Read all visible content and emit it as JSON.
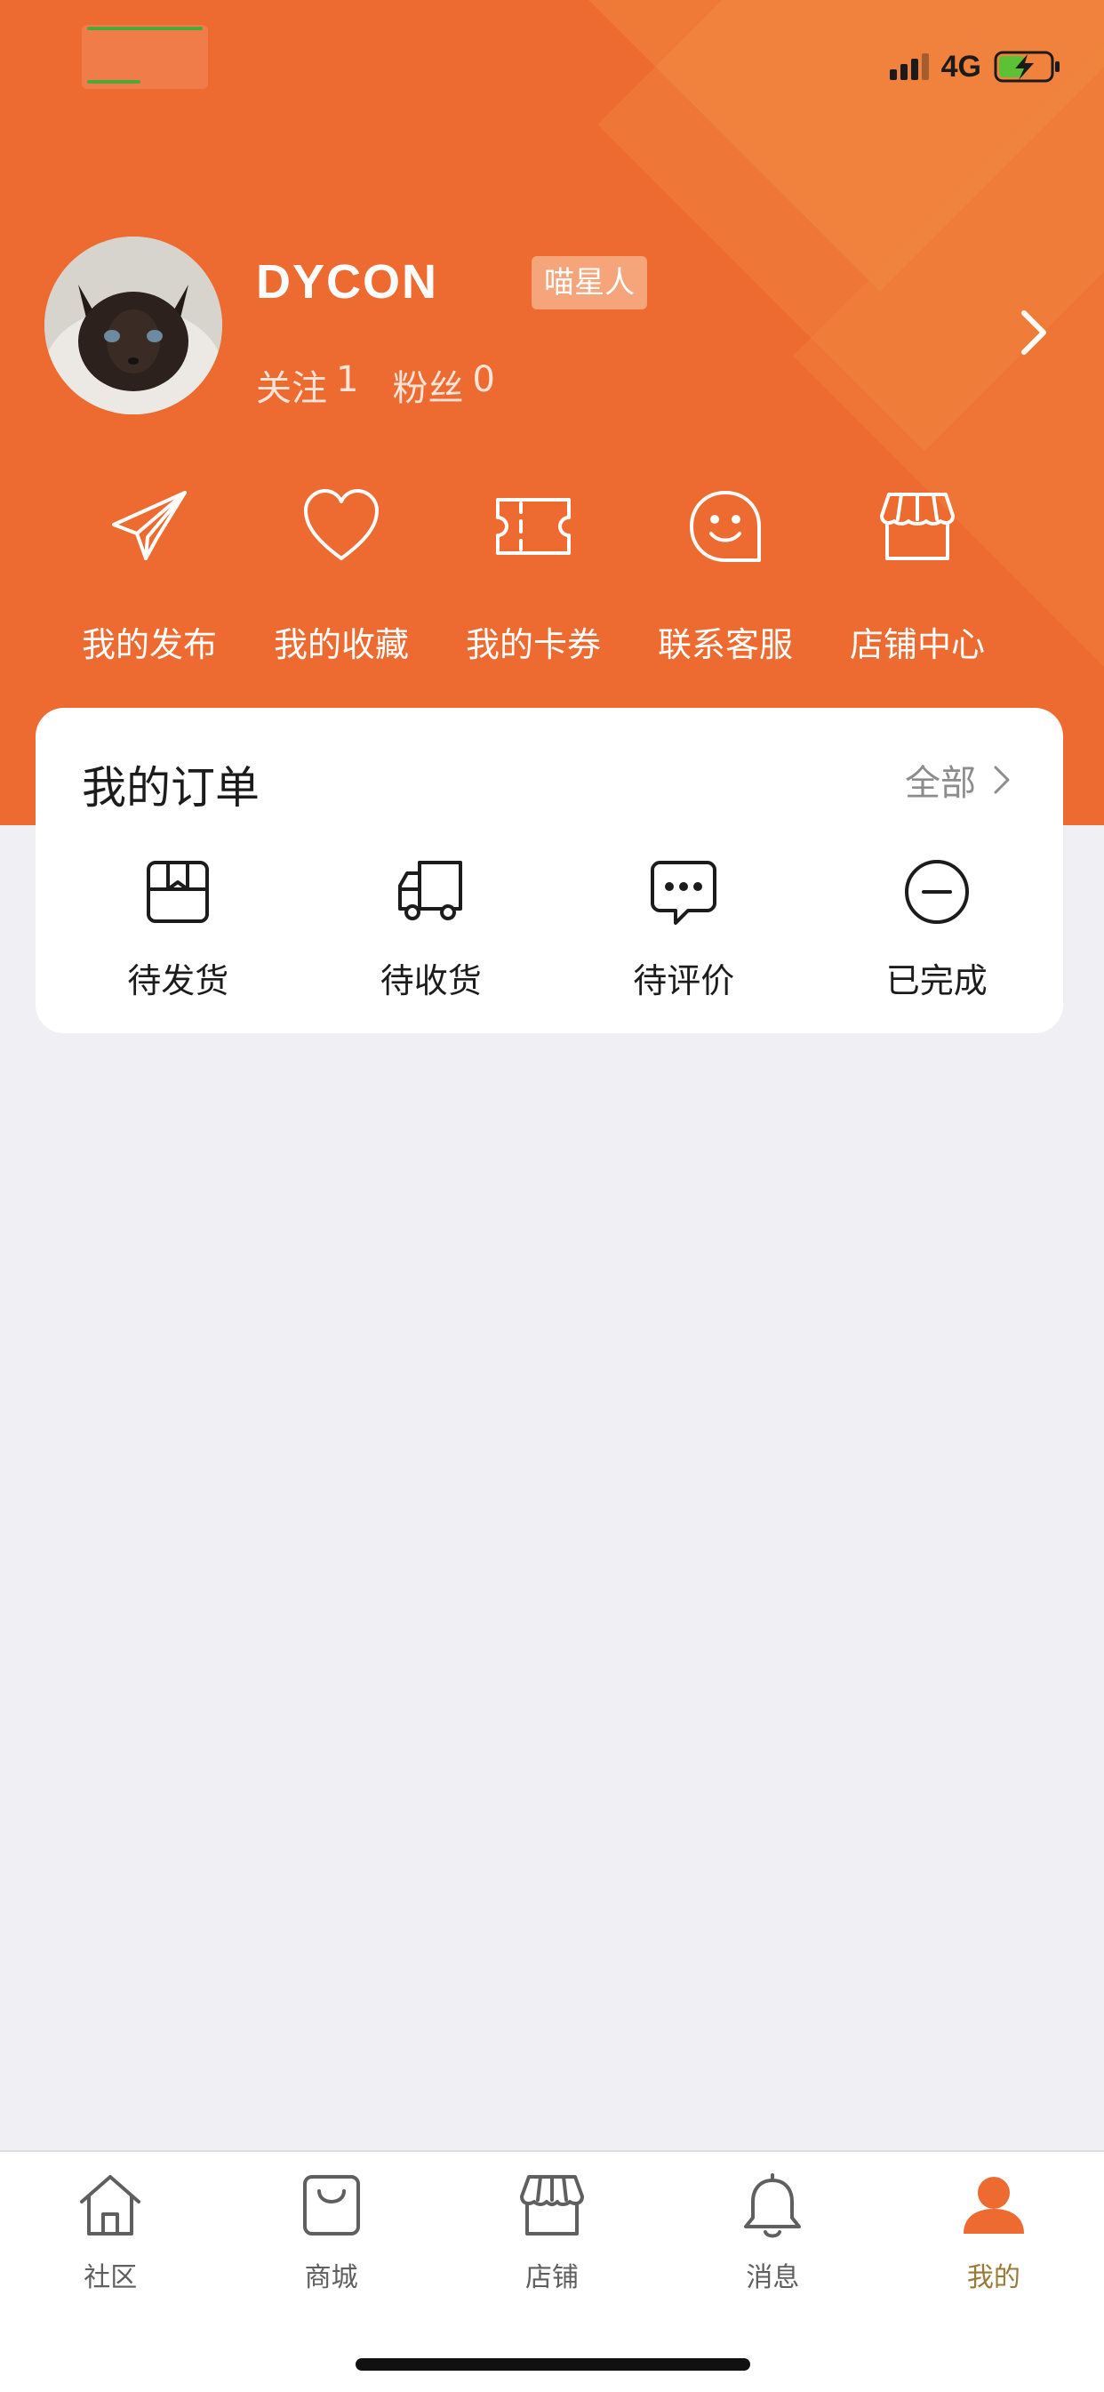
{
  "theme": {
    "accent": "#ED6A30",
    "page_bg": "#EFEFF4",
    "card_bg": "#FFFFFF",
    "active_tab_color": "#9B7A37",
    "inactive_tab_color": "#5F5F5F"
  },
  "status_bar": {
    "network": "4G",
    "signal_icon": "cellular-signal-icon",
    "battery_icon": "battery-charging-icon"
  },
  "profile": {
    "name": "DYCON",
    "badge": "喵星人",
    "following": {
      "label": "关注",
      "value": "1"
    },
    "followers": {
      "label": "粉丝",
      "value": "0"
    },
    "avatar_icon": "cat-avatar-icon",
    "chevron_icon": "chevron-right-icon"
  },
  "quick_actions": [
    {
      "label": "我的发布",
      "icon": "paper-plane-icon"
    },
    {
      "label": "我的收藏",
      "icon": "heart-icon"
    },
    {
      "label": "我的卡券",
      "icon": "ticket-icon"
    },
    {
      "label": "联系客服",
      "icon": "smile-chat-icon"
    },
    {
      "label": "店铺中心",
      "icon": "store-icon"
    }
  ],
  "orders": {
    "title": "我的订单",
    "all_label": "全部",
    "items": [
      {
        "label": "待发货",
        "icon": "box-icon"
      },
      {
        "label": "待收货",
        "icon": "truck-icon"
      },
      {
        "label": "待评价",
        "icon": "chat-bubble-icon"
      },
      {
        "label": "已完成",
        "icon": "minus-circle-icon"
      }
    ]
  },
  "tab_bar": {
    "active_index": 4,
    "items": [
      {
        "label": "社区",
        "icon": "home-icon"
      },
      {
        "label": "商城",
        "icon": "shopping-bag-icon"
      },
      {
        "label": "店铺",
        "icon": "store-icon"
      },
      {
        "label": "消息",
        "icon": "bell-icon"
      },
      {
        "label": "我的",
        "icon": "person-icon"
      }
    ]
  }
}
